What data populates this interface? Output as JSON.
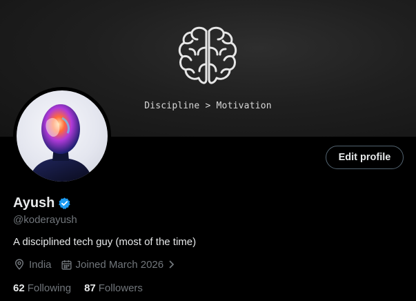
{
  "banner": {
    "icon": "brain-icon",
    "tagline": "Discipline > Motivation",
    "bg_color": "#1f1f1f"
  },
  "profile": {
    "avatar": "avatar",
    "name": "Ayush",
    "verified_color": "#1d9bf0",
    "handle": "@koderayush",
    "bio": "A disciplined tech guy (most of the time)",
    "location": "India",
    "joined": "Joined March 2026",
    "following_count": "62",
    "following_label": "Following",
    "followers_count": "87",
    "followers_label": "Followers"
  },
  "actions": {
    "edit_profile_label": "Edit profile"
  }
}
